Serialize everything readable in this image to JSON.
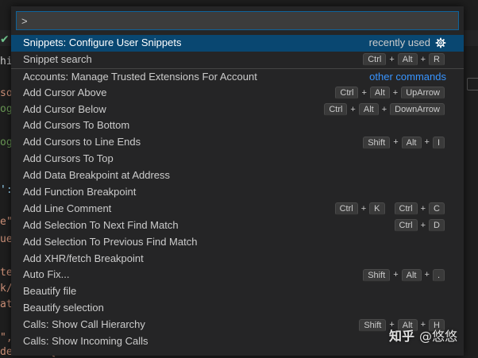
{
  "background": {
    "lines": [
      {
        "text": "hin",
        "color": "#cccccc"
      },
      {
        "text": "so",
        "color": "#ce9178"
      },
      {
        "text": "og",
        "color": "#6a9955"
      },
      {
        "text": "og",
        "color": "#6a9955"
      },
      {
        "text": "':",
        "color": "#9cdcfe"
      },
      {
        "text": "e\"",
        "color": "#ce9178"
      },
      {
        "text": "ue",
        "color": "#ce9178"
      },
      {
        "text": "te",
        "color": "#ce9178"
      },
      {
        "text": "k/",
        "color": "#ce9178"
      },
      {
        "text": "at",
        "color": "#ce9178"
      },
      {
        "text": "\",",
        "color": "#ce9178"
      },
      {
        "text": "default {\"",
        "color": "#ce9178"
      }
    ]
  },
  "palette": {
    "input_value": ">",
    "items": [
      {
        "label": "Snippets: Configure User Snippets",
        "hint": "recently used",
        "hint_type": "recent",
        "selected": true
      },
      {
        "label": "Snippet search",
        "keys": [
          [
            "Ctrl",
            "Alt",
            "R"
          ]
        ]
      },
      {
        "label": "Accounts: Manage Trusted Extensions For Account",
        "hint": "other commands",
        "hint_type": "link",
        "separator": true
      },
      {
        "label": "Add Cursor Above",
        "keys": [
          [
            "Ctrl",
            "Alt",
            "UpArrow"
          ]
        ]
      },
      {
        "label": "Add Cursor Below",
        "keys": [
          [
            "Ctrl",
            "Alt",
            "DownArrow"
          ]
        ]
      },
      {
        "label": "Add Cursors To Bottom"
      },
      {
        "label": "Add Cursors to Line Ends",
        "keys": [
          [
            "Shift",
            "Alt",
            "I"
          ]
        ]
      },
      {
        "label": "Add Cursors To Top"
      },
      {
        "label": "Add Data Breakpoint at Address"
      },
      {
        "label": "Add Function Breakpoint"
      },
      {
        "label": "Add Line Comment",
        "keys": [
          [
            "Ctrl",
            "K"
          ],
          [
            "Ctrl",
            "C"
          ]
        ]
      },
      {
        "label": "Add Selection To Next Find Match",
        "keys": [
          [
            "Ctrl",
            "D"
          ]
        ]
      },
      {
        "label": "Add Selection To Previous Find Match"
      },
      {
        "label": "Add XHR/fetch Breakpoint"
      },
      {
        "label": "Auto Fix...",
        "keys": [
          [
            "Shift",
            "Alt",
            "."
          ]
        ]
      },
      {
        "label": "Beautify file"
      },
      {
        "label": "Beautify selection"
      },
      {
        "label": "Calls: Show Call Hierarchy",
        "keys": [
          [
            "Shift",
            "Alt",
            "H"
          ]
        ]
      },
      {
        "label": "Calls: Show Incoming Calls"
      }
    ]
  },
  "watermark": {
    "brand": "知乎",
    "author": "@悠悠"
  },
  "colors": {
    "accent": "#0e639c",
    "selection": "#094771",
    "link": "#3794ff"
  },
  "icons": {
    "gear": "gear-icon",
    "check": "check-icon"
  }
}
